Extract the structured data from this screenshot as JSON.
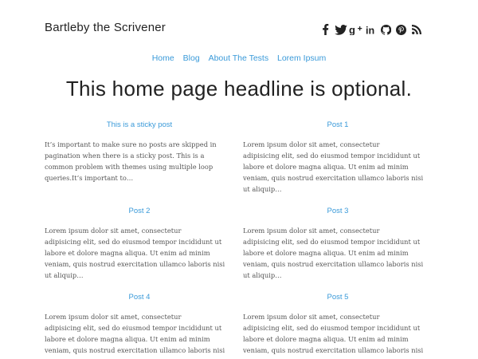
{
  "site": {
    "title": "Bartleby the Scrivener"
  },
  "social_icons": [
    "facebook-icon",
    "twitter-icon",
    "google-plus-icon",
    "linkedin-icon",
    "github-icon",
    "pinterest-icon",
    "rss-icon"
  ],
  "nav": {
    "items": [
      "Home",
      "Blog",
      "About The Tests",
      "Lorem Ipsum"
    ]
  },
  "headline": "This home page headline is optional.",
  "colors": {
    "link": "#3a9ad9",
    "text": "#555555",
    "title": "#222222"
  },
  "posts": [
    {
      "title": "This is a sticky post",
      "excerpt": "It’s important to make sure no posts are skipped in\npagination when there is a sticky post. This is a\ncommon problem with themes using multiple loop\nqueries.It’s important to…"
    },
    {
      "title": "Post 1",
      "excerpt": "Lorem ipsum dolor sit amet, consectetur\nadipisicing elit, sed do eiusmod tempor incididunt ut\nlabore et dolore magna aliqua. Ut enim ad minim\nveniam, quis nostrud exercitation ullamco laboris nisi\nut aliquip…"
    },
    {
      "title": "Post 2",
      "excerpt": "Lorem ipsum dolor sit amet, consectetur\nadipisicing elit, sed do eiusmod tempor incididunt ut\nlabore et dolore magna aliqua. Ut enim ad minim\nveniam, quis nostrud exercitation ullamco laboris nisi\nut aliquip…"
    },
    {
      "title": "Post 3",
      "excerpt": "Lorem ipsum dolor sit amet, consectetur\nadipisicing elit, sed do eiusmod tempor incididunt ut\nlabore et dolore magna aliqua. Ut enim ad minim\nveniam, quis nostrud exercitation ullamco laboris nisi\nut aliquip…"
    },
    {
      "title": "Post 4",
      "excerpt": "Lorem ipsum dolor sit amet, consectetur\nadipisicing elit, sed do eiusmod tempor incididunt ut\nlabore et dolore magna aliqua. Ut enim ad minim\nveniam, quis nostrud exercitation ullamco laboris nisi"
    },
    {
      "title": "Post 5",
      "excerpt": "Lorem ipsum dolor sit amet, consectetur\nadipisicing elit, sed do eiusmod tempor incididunt ut\nlabore et dolore magna aliqua. Ut enim ad minim\nveniam, quis nostrud exercitation ullamco laboris nisi"
    }
  ]
}
